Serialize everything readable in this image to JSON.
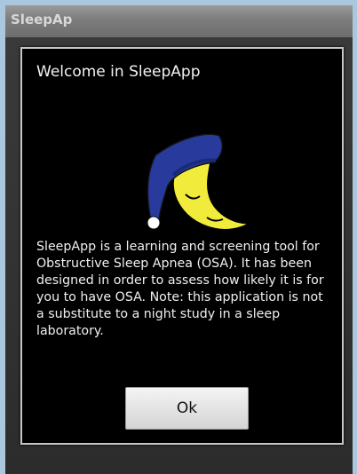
{
  "app": {
    "title": "SleepAp"
  },
  "dialog": {
    "title": "Welcome in SleepApp",
    "message": "SleepApp is a learning and screening tool for Obstructive Sleep Apnea (OSA). It has been designed in order to assess how likely it is for you to have OSA. Note: this application is not a substitute to a night study in a sleep laboratory.",
    "ok_label": "Ok",
    "icon": "sleeping-moon-icon"
  },
  "colors": {
    "desktop": "#a9c8de",
    "dialog_background": "#000000",
    "moon": "#f1ec3c",
    "nightcap": "#283a9c",
    "pompom": "#ffffff"
  }
}
